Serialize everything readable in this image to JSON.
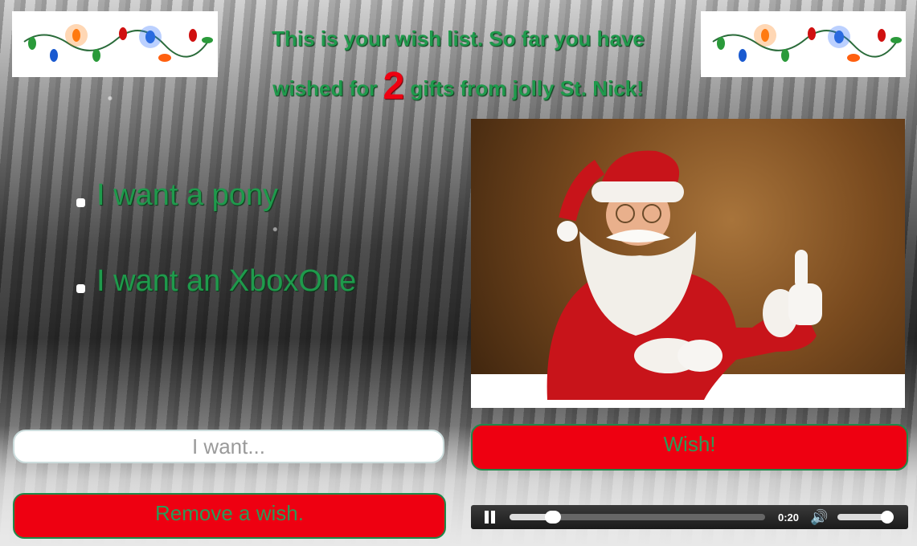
{
  "heading": {
    "line1": "This is your wish list. So far you have",
    "prefix": "wished for",
    "count": "2",
    "suffix": "gifts from jolly St. Nick!"
  },
  "wishes": [
    {
      "text": "I want a pony"
    },
    {
      "text": "I want an XboxOne"
    }
  ],
  "input": {
    "placeholder": "I want..."
  },
  "buttons": {
    "wish": "Wish!",
    "remove": "Remove a wish."
  },
  "player": {
    "time": "0:20",
    "progress_percent": 17,
    "volume_percent": 100
  },
  "icons": {
    "pause": "pause-icon",
    "volume": "volume-icon"
  },
  "colors": {
    "accent_red": "#ee0011",
    "accent_green": "#1f9a4c"
  }
}
